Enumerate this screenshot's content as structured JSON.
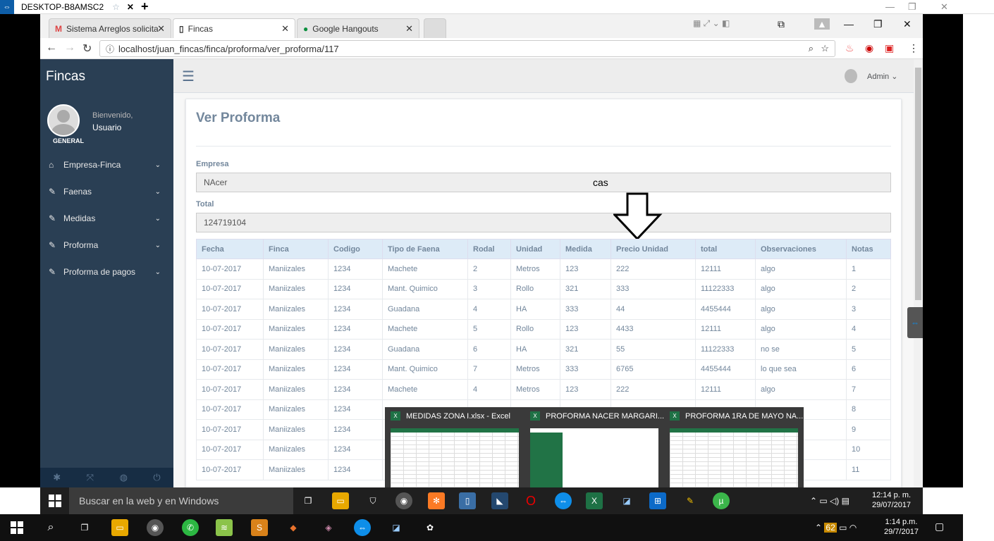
{
  "teamviewer": {
    "title": "DESKTOP-B8AMSC2"
  },
  "browser": {
    "tabs": [
      {
        "label": "Sistema Arreglos solicita",
        "icon": "M"
      },
      {
        "label": "Fincas",
        "icon": "▯"
      },
      {
        "label": "Google Hangouts",
        "icon": "●"
      }
    ],
    "url": "localhost/juan_fincas/finca/proforma/ver_proforma/117"
  },
  "sidebar": {
    "brand": "Fincas",
    "welcome": "Bienvenido,",
    "user": "Usuario",
    "role": "GENERAL",
    "items": [
      {
        "label": "Empresa-Finca",
        "icon": "⌂"
      },
      {
        "label": "Faenas",
        "icon": "✎"
      },
      {
        "label": "Medidas",
        "icon": "✎"
      },
      {
        "label": "Proforma",
        "icon": "✎"
      },
      {
        "label": "Proforma de pagos",
        "icon": "✎"
      }
    ]
  },
  "topnav": {
    "user": "Admin ⌄"
  },
  "panel": {
    "title": "Ver Proforma",
    "empresa_label": "Empresa",
    "empresa_value": "NAcer",
    "total_label": "Total",
    "total_value": "124719104",
    "annotation": "cas"
  },
  "table": {
    "headers": [
      "Fecha",
      "Finca",
      "Codigo",
      "Tipo de Faena",
      "Rodal",
      "Unidad",
      "Medida",
      "Precio Unidad",
      "total",
      "Observaciones",
      "Notas"
    ],
    "rows": [
      [
        "10-07-2017",
        "Maniizales",
        "1234",
        "Machete",
        "2",
        "Metros",
        "123",
        "222",
        "12111",
        "algo",
        "1"
      ],
      [
        "10-07-2017",
        "Maniizales",
        "1234",
        "Mant. Quimico",
        "3",
        "Rollo",
        "321",
        "333",
        "11122333",
        "algo",
        "2"
      ],
      [
        "10-07-2017",
        "Maniizales",
        "1234",
        "Guadana",
        "4",
        "HA",
        "333",
        "44",
        "4455444",
        "algo",
        "3"
      ],
      [
        "10-07-2017",
        "Maniizales",
        "1234",
        "Machete",
        "5",
        "Rollo",
        "123",
        "4433",
        "12111",
        "algo",
        "4"
      ],
      [
        "10-07-2017",
        "Maniizales",
        "1234",
        "Guadana",
        "6",
        "HA",
        "321",
        "55",
        "11122333",
        "no se",
        "5"
      ],
      [
        "10-07-2017",
        "Maniizales",
        "1234",
        "Mant. Quimico",
        "7",
        "Metros",
        "333",
        "6765",
        "4455444",
        "lo que sea",
        "6"
      ],
      [
        "10-07-2017",
        "Maniizales",
        "1234",
        "Machete",
        "4",
        "Metros",
        "123",
        "222",
        "12111",
        "algo",
        "7"
      ],
      [
        "10-07-2017",
        "Maniizales",
        "1234",
        "",
        "",
        "",
        "",
        "",
        "",
        "",
        "8"
      ],
      [
        "10-07-2017",
        "Maniizales",
        "1234",
        "",
        "",
        "",
        "",
        "",
        "",
        "",
        "9"
      ],
      [
        "10-07-2017",
        "Maniizales",
        "1234",
        "",
        "",
        "",
        "",
        "",
        "",
        "",
        "10"
      ],
      [
        "10-07-2017",
        "Maniizales",
        "1234",
        "",
        "",
        "",
        "",
        "",
        "",
        "",
        "11"
      ]
    ]
  },
  "thumbnails": [
    {
      "label": "MEDIDAS ZONA I.xlsx - Excel"
    },
    {
      "label": "PROFORMA NACER MARGARI..."
    },
    {
      "label": "PROFORMA 1RA DE MAYO  NA..."
    }
  ],
  "taskbar1": {
    "search": "Buscar en la web y en Windows",
    "time": "12:14 p. m.",
    "date": "29/07/2017"
  },
  "taskbar2": {
    "time": "1:14 p.m.",
    "date": "29/7/2017",
    "badge": "62"
  }
}
